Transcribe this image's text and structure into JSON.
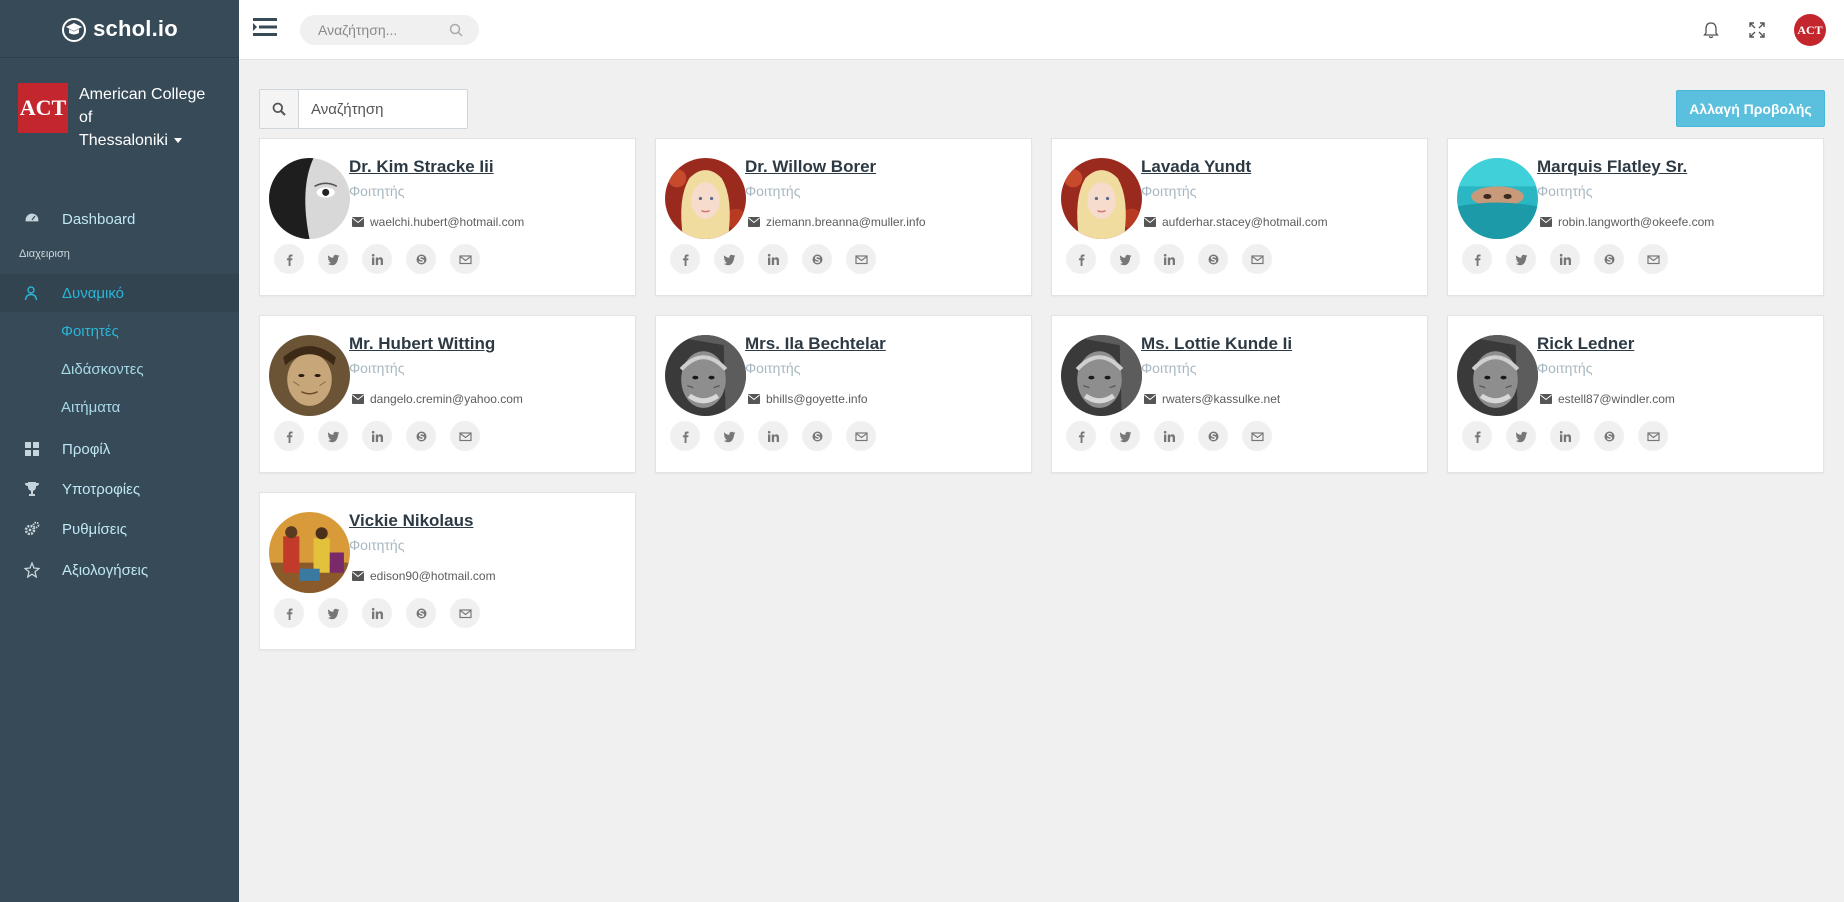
{
  "brand": {
    "name": "schol.io"
  },
  "organization": {
    "logo_text": "ACT",
    "name_line1": "American College of",
    "name_line2": "Thessaloniki"
  },
  "sidebar": {
    "dashboard": "Dashboard",
    "section_label": "Διαχειριση",
    "dynamic": "Δυναμικό",
    "sub_items": [
      "Φοιτητές",
      "Διδάσκοντες",
      "Αιτήματα"
    ],
    "profile": "Προφίλ",
    "scholarships": "Υποτροφίες",
    "settings": "Ρυθμίσεις",
    "reviews": "Αξιολογήσεις"
  },
  "topbar": {
    "search_placeholder": "Αναζήτηση...",
    "avatar_text": "ACT"
  },
  "content": {
    "search_placeholder": "Αναζήτηση",
    "view_button": "Αλλαγή Προβολής"
  },
  "people": [
    {
      "name": "Dr. Kim Stracke Iii",
      "role": "Φοιτητής",
      "email": "waelchi.hubert@hotmail.com",
      "photo": "bw-woman"
    },
    {
      "name": "Dr. Willow Borer",
      "role": "Φοιτητής",
      "email": "ziemann.breanna@muller.info",
      "photo": "blonde"
    },
    {
      "name": "Lavada Yundt",
      "role": "Φοιτητής",
      "email": "aufderhar.stacey@hotmail.com",
      "photo": "blonde"
    },
    {
      "name": "Marquis Flatley Sr.",
      "role": "Φοιτητής",
      "email": "robin.langworth@okeefe.com",
      "photo": "teal-scarf"
    },
    {
      "name": "Mr. Hubert Witting",
      "role": "Φοιτητής",
      "email": "dangelo.cremin@yahoo.com",
      "photo": "old-woman"
    },
    {
      "name": "Mrs. Ila Bechtelar",
      "role": "Φοιτητής",
      "email": "bhills@goyette.info",
      "photo": "old-man"
    },
    {
      "name": "Ms. Lottie Kunde Ii",
      "role": "Φοιτητής",
      "email": "rwaters@kassulke.net",
      "photo": "old-man"
    },
    {
      "name": "Rick Ledner",
      "role": "Φοιτητής",
      "email": "estell87@windler.com",
      "photo": "old-man"
    },
    {
      "name": "Vickie Nikolaus",
      "role": "Φοιτητής",
      "email": "edison90@hotmail.com",
      "photo": "market"
    }
  ],
  "social_icons": [
    "facebook-icon",
    "twitter-icon",
    "linkedin-icon",
    "skype-icon",
    "envelope-icon"
  ],
  "colors": {
    "sidebar": "#374a57",
    "accent": "#2bb5d8",
    "act_red": "#c4262e",
    "button": "#5bc0de"
  }
}
